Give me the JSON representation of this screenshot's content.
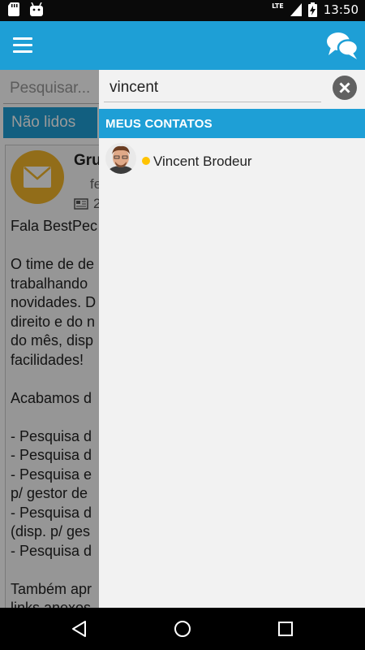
{
  "status_bar": {
    "network": "LTE",
    "time": "13:50"
  },
  "app_bar": {
    "menu_icon": "hamburger-icon",
    "chat_icon": "chat-bubbles-icon",
    "color": "#1e9fd6"
  },
  "background": {
    "search_placeholder": "Pesquisar...",
    "unread_tab": "Não lidos",
    "card": {
      "title": "Gru",
      "subtitle": "fe",
      "meta": "2",
      "body": "Fala BestPec\n\nO time de de\ntrabalhando \nnovidades. D\ndireito e do n\ndo mês, disp\nfacilidades!\n\nAcabamos d\n\n- Pesquisa d\n- Pesquisa d\n- Pesquisa e\np/ gestor de\n- Pesquisa d\n(disp. p/ ges\n- Pesquisa d\n\nTambém apr\nlinks anexos"
    }
  },
  "drawer": {
    "search": {
      "value": "vincent",
      "placeholder": "Pesquisar..."
    },
    "section_title": "MEUS CONTATOS",
    "contacts": [
      {
        "name": "Vincent Brodeur",
        "status_color": "#ffc300"
      }
    ]
  },
  "nav": {
    "back": "back-icon",
    "home": "home-icon",
    "recents": "recents-icon"
  }
}
